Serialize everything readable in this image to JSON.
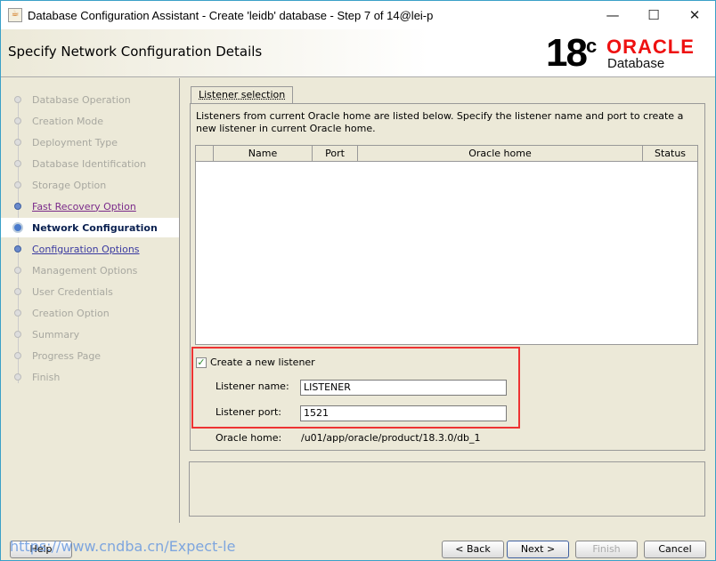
{
  "window": {
    "title": "Database Configuration Assistant - Create 'leidb' database - Step 7 of 14@lei-p",
    "minimize": "—",
    "maximize": "☐",
    "close": "✕"
  },
  "header": {
    "title": "Specify Network Configuration Details",
    "logo_version": "18",
    "logo_sup": "c",
    "logo_brand": "ORACLE",
    "logo_product": "Database"
  },
  "steps": [
    {
      "label": "Database Operation",
      "state": "done"
    },
    {
      "label": "Creation Mode",
      "state": "done"
    },
    {
      "label": "Deployment Type",
      "state": "done"
    },
    {
      "label": "Database Identification",
      "state": "done"
    },
    {
      "label": "Storage Option",
      "state": "done"
    },
    {
      "label": "Fast Recovery Option",
      "state": "visited"
    },
    {
      "label": "Network Configuration",
      "state": "current"
    },
    {
      "label": "Configuration Options",
      "state": "link"
    },
    {
      "label": "Management Options",
      "state": "todo"
    },
    {
      "label": "User Credentials",
      "state": "todo"
    },
    {
      "label": "Creation Option",
      "state": "todo"
    },
    {
      "label": "Summary",
      "state": "todo"
    },
    {
      "label": "Progress Page",
      "state": "todo"
    },
    {
      "label": "Finish",
      "state": "todo"
    }
  ],
  "main": {
    "tab": "Listener selection",
    "description": "Listeners from current Oracle home are listed below. Specify the listener name and port to create a new listener in current Oracle home.",
    "columns": [
      "",
      "Name",
      "Port",
      "Oracle home",
      "Status"
    ],
    "rows": [],
    "create_listener": {
      "label": "Create a new listener",
      "checked": true
    },
    "listener_name": {
      "label": "Listener name:",
      "value": "LISTENER"
    },
    "listener_port": {
      "label": "Listener port:",
      "value": "1521"
    },
    "oracle_home": {
      "label": "Oracle home:",
      "value": "/u01/app/oracle/product/18.3.0/db_1"
    }
  },
  "buttons": {
    "help": "Help",
    "back": "< Back",
    "next": "Next >",
    "finish": "Finish",
    "cancel": "Cancel"
  },
  "watermark": "https://www.cndba.cn/Expect-le"
}
